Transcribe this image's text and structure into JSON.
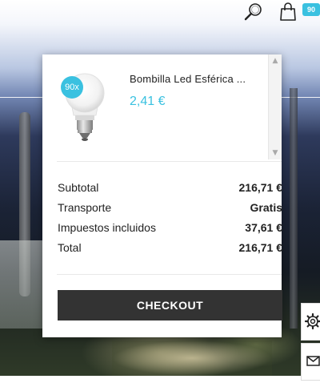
{
  "header": {
    "search_icon": "search-icon",
    "cart_icon": "shopping-bag-icon",
    "cart_count": "90"
  },
  "cart": {
    "items": [
      {
        "name": "Bombilla Led Esférica ...",
        "price": "2,41 €",
        "quantity": "90x",
        "image_icon": "led-bulb-icon"
      }
    ],
    "totals": {
      "subtotal_label": "Subtotal",
      "subtotal_value": "216,71 €",
      "shipping_label": "Transporte",
      "shipping_value": "Gratis",
      "tax_label": "Impuestos incluidos",
      "tax_value": "37,61 €",
      "total_label": "Total",
      "total_value": "216,71 €"
    },
    "checkout_label": "CHECKOUT"
  },
  "side_tools": [
    "gear-icon",
    "envelope-icon"
  ],
  "colors": {
    "accent": "#3ac1e0",
    "button_bg": "#333333",
    "text": "#222222"
  }
}
